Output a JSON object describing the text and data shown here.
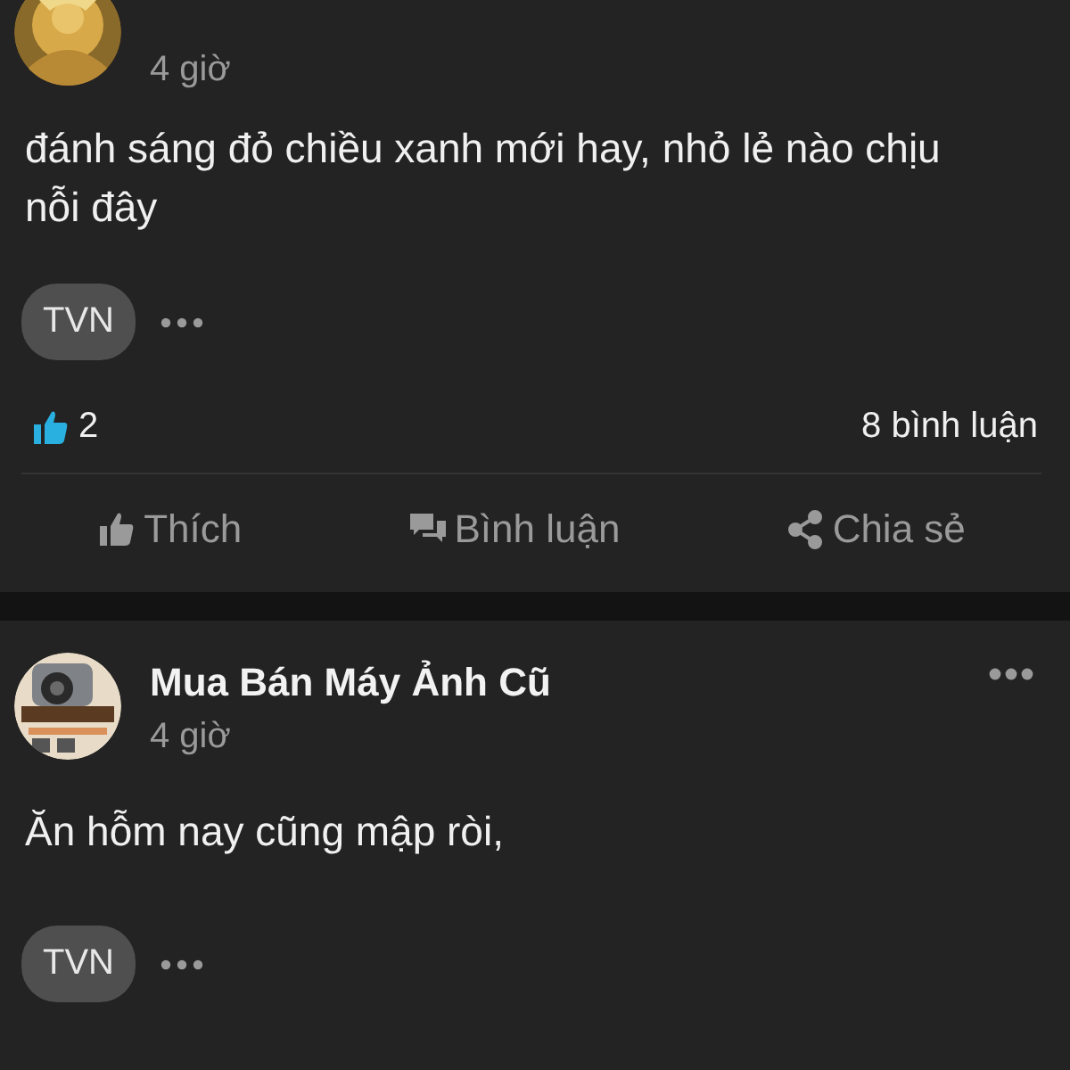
{
  "posts": [
    {
      "time": "4 giờ",
      "text": "đánh sáng đỏ chiều xanh mới hay, nhỏ lẻ nào chịu nỗi đây",
      "tag": "TVN",
      "likes": "2",
      "comments": "8 bình luận",
      "actions": [
        {
          "kind": "like",
          "label": "Thích"
        },
        {
          "kind": "comment",
          "label": "Bình luận"
        },
        {
          "kind": "share",
          "label": "Chia sẻ"
        }
      ]
    },
    {
      "author": "Mua Bán Máy Ảnh Cũ",
      "time": "4 giờ",
      "text": "Ăn hỗm nay cũng mập ròi,",
      "tag": "TVN",
      "has_menu": true
    }
  ]
}
